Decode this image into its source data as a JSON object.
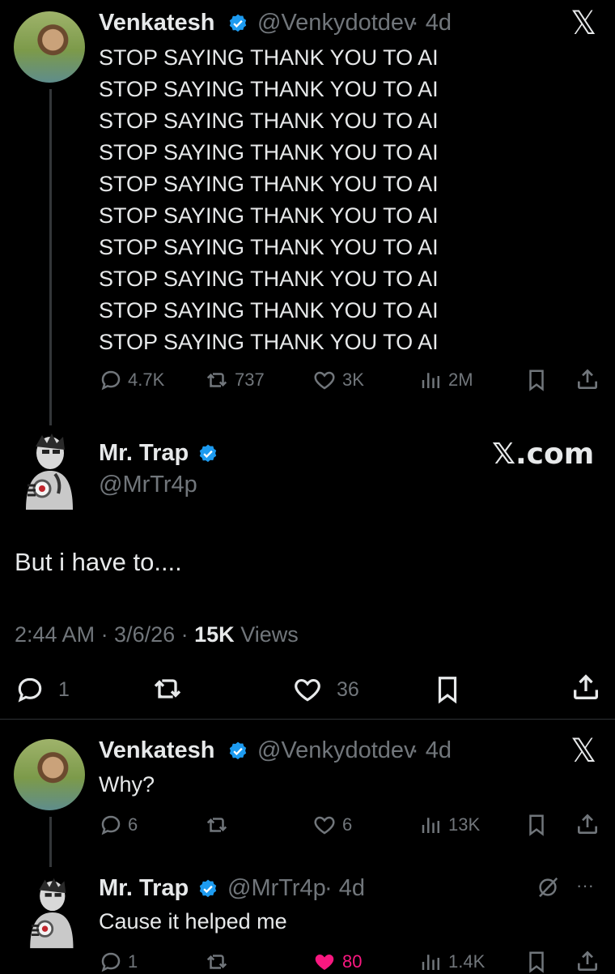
{
  "tweets": [
    {
      "name": "Venkatesh",
      "handle": "@Venkydotdev",
      "time": "· 4d",
      "lines": [
        "STOP SAYING THANK YOU TO AI",
        "STOP SAYING THANK YOU TO AI",
        "STOP SAYING THANK YOU TO AI",
        "STOP SAYING THANK YOU TO AI",
        "STOP SAYING THANK YOU TO AI",
        "STOP SAYING THANK YOU TO AI",
        "STOP SAYING THANK YOU TO AI",
        "STOP SAYING THANK YOU TO AI",
        "STOP SAYING THANK YOU TO AI",
        "STOP SAYING THANK YOU TO AI"
      ],
      "replies": "4.7K",
      "reposts": "737",
      "likes": "3K",
      "views": "2M",
      "corner": "𝕏"
    },
    {
      "name": "Mr. Trap",
      "handle": "@MrTr4p",
      "brand": "𝕏.com",
      "text": "But i have to....",
      "time": "2:44 AM · 3/6/26 ·",
      "views_count": "15K",
      "views_label": "Views",
      "replies": "1",
      "likes": "36"
    },
    {
      "name": "Venkatesh",
      "handle": "@Venkydotdev",
      "time": "· 4d",
      "text": "Why?",
      "replies": "6",
      "likes": "6",
      "views": "13K",
      "corner": "𝕏"
    },
    {
      "name": "Mr. Trap",
      "handle": "@MrTr4p",
      "time": "· 4d",
      "text": "Cause it helped me",
      "replies": "1",
      "likes": "80",
      "views": "1.4K",
      "more": "···"
    }
  ],
  "colors": {
    "verified": "#1d9bf0",
    "like_active": "#f91880",
    "muted": "#71767b"
  }
}
